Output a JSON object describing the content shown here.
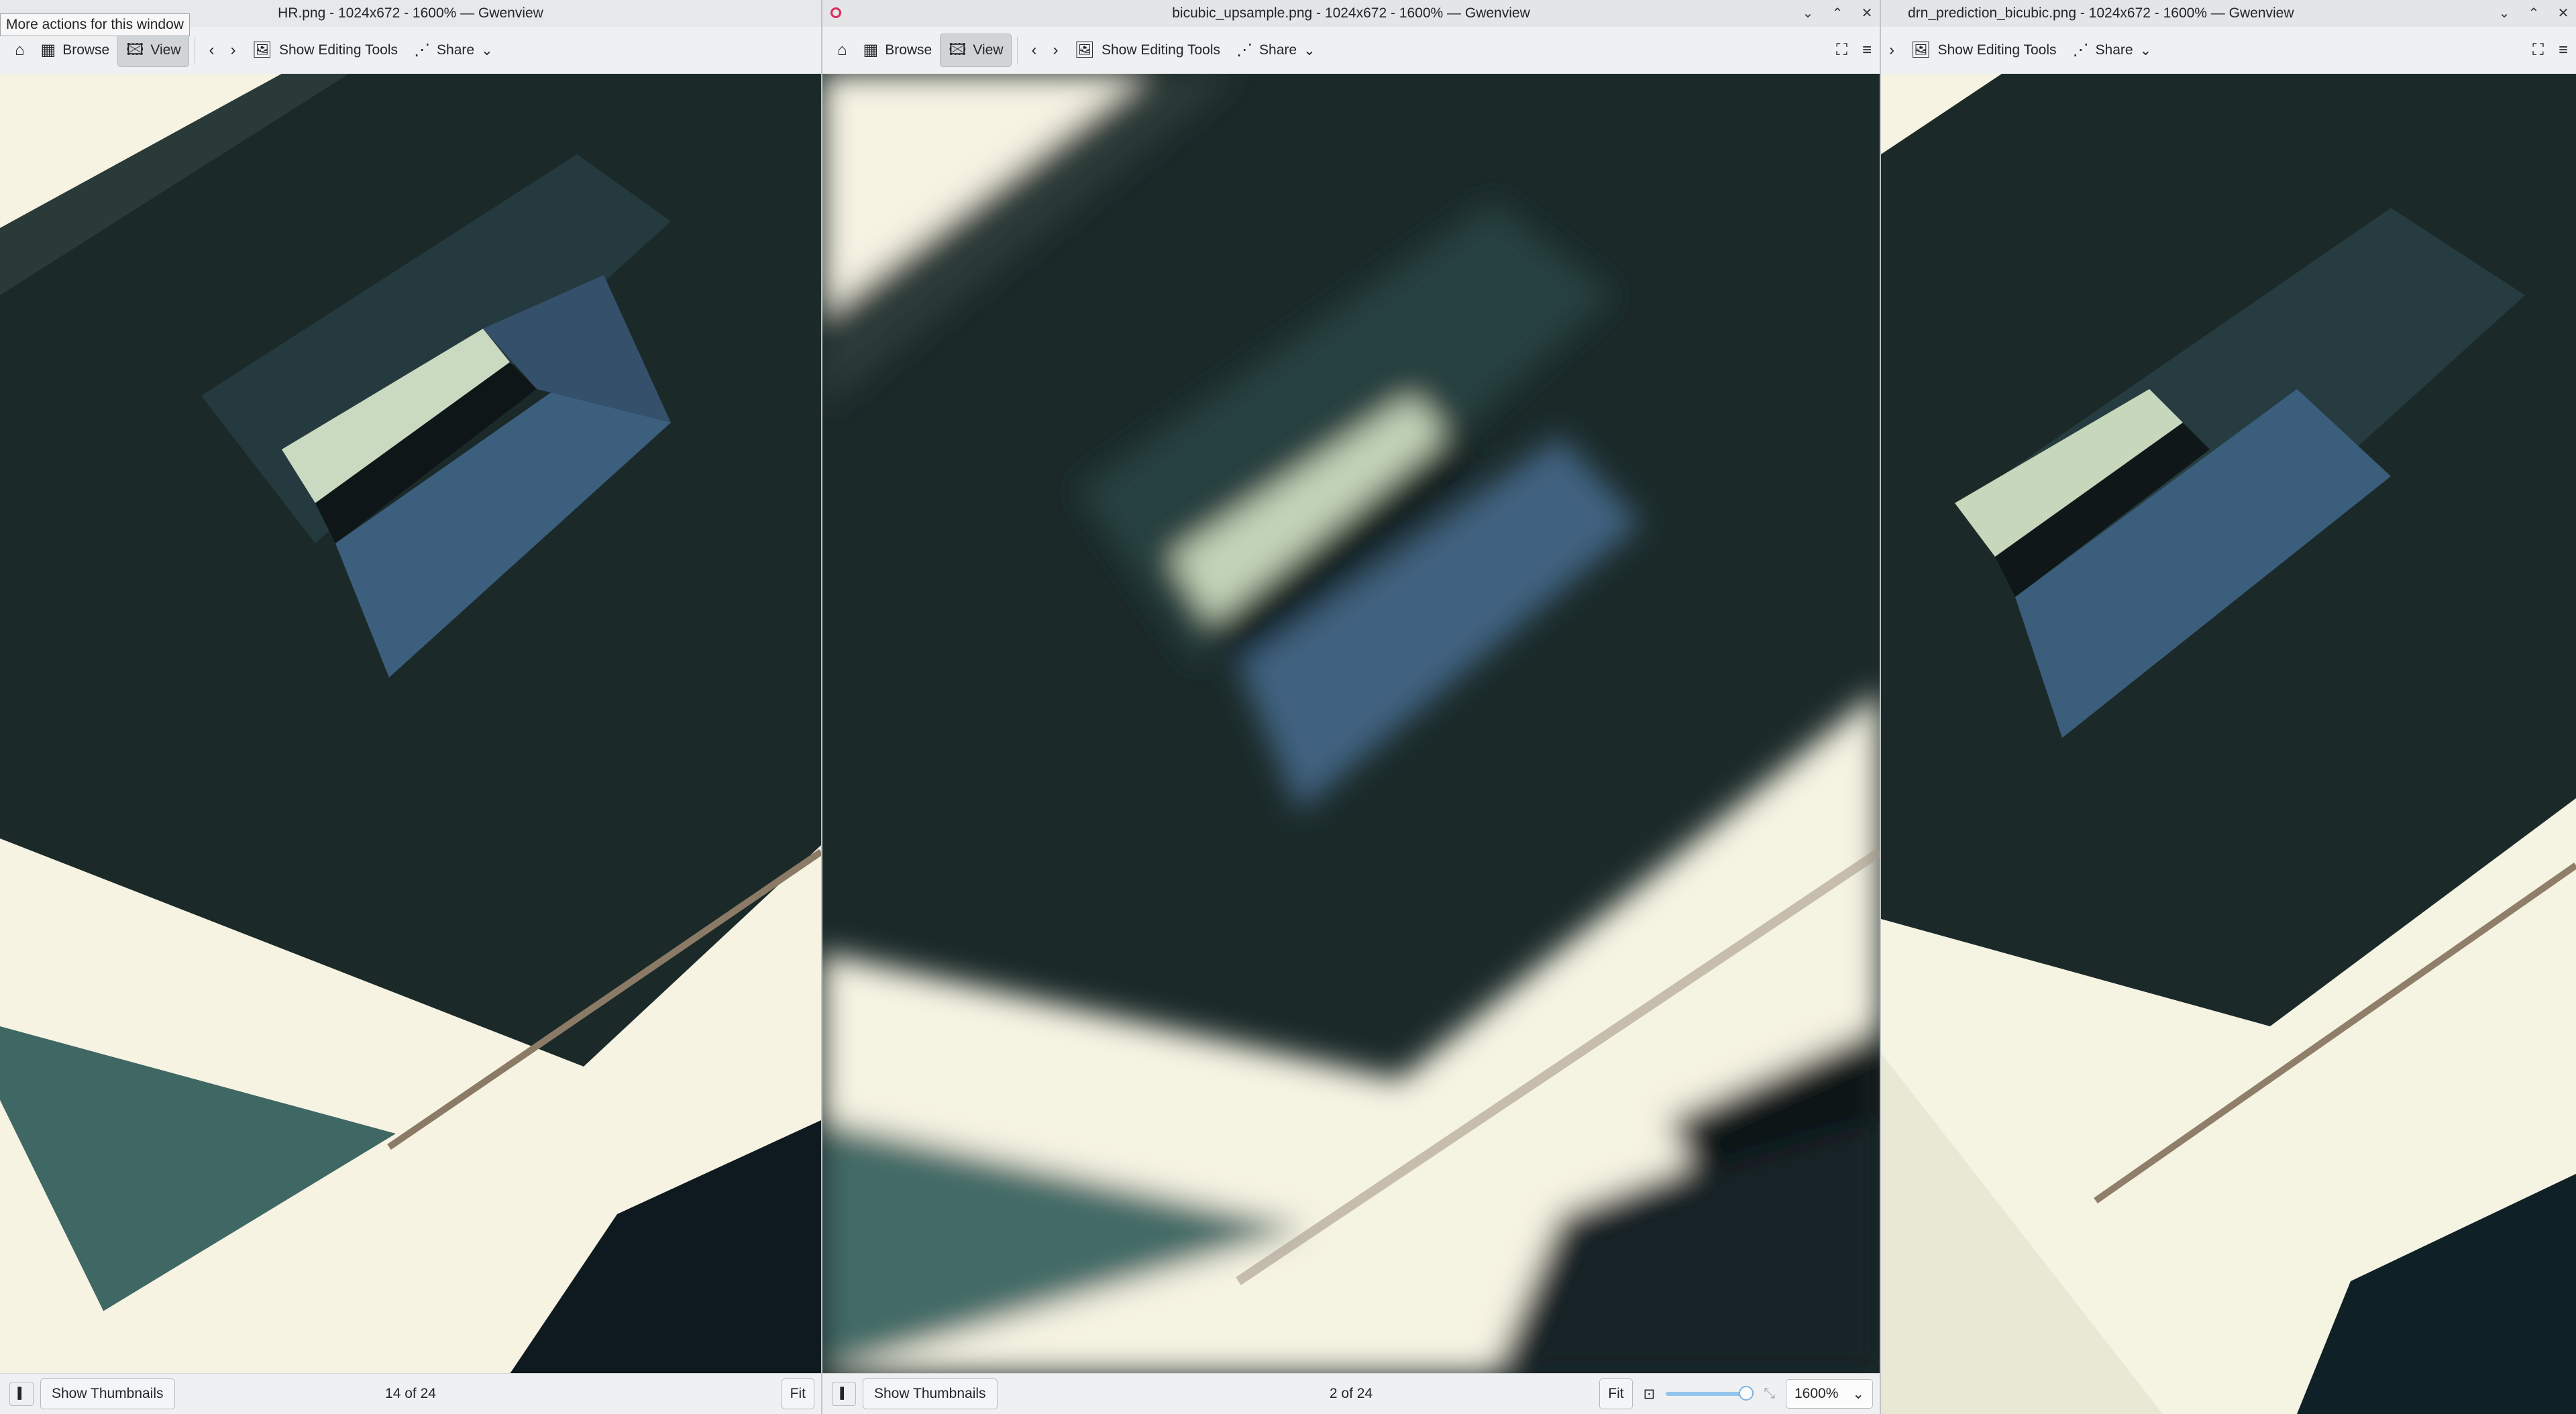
{
  "tooltip": "More actions for this window",
  "windows": [
    {
      "title": "HR.png - 1024x672 - 1600% — Gwenview",
      "toolbar": {
        "home": "⌂",
        "browse": "Browse",
        "view": "View",
        "prev": "‹",
        "next": "›",
        "edit": "Show Editing Tools",
        "share": "Share"
      },
      "status": {
        "thumbs": "Show Thumbnails",
        "count": "14 of 24",
        "fit": "Fit"
      }
    },
    {
      "title": "bicubic_upsample.png - 1024x672 - 1600% — Gwenview",
      "toolbar": {
        "home": "⌂",
        "browse": "Browse",
        "view": "View",
        "prev": "‹",
        "next": "›",
        "edit": "Show Editing Tools",
        "share": "Share"
      },
      "status": {
        "thumbs": "Show Thumbnails",
        "count": "2 of 24",
        "fit": "Fit",
        "zoom": "1600%",
        "zoom_slider_fraction": 0.92
      }
    },
    {
      "title": "drn_prediction_bicubic.png - 1024x672 - 1600% — Gwenview",
      "toolbar": {
        "next": "›",
        "edit": "Show Editing Tools",
        "share": "Share"
      }
    }
  ],
  "icons": {
    "minimize": "⌄",
    "maximize": "⌃",
    "close": "✕",
    "fullscreen": "⛶",
    "menu": "≡",
    "dropdown": "⌄",
    "share": "⋰",
    "edit": "🖼",
    "sidebar": "▌",
    "zoom_fit": "⊡",
    "zoom_full": "⤡"
  },
  "colors": {
    "accent": "#3daee9",
    "titlebar": "#e3e5e7",
    "toolbar": "#eff0f1",
    "image_dark": "#1a2624",
    "image_light": "#f7f5e6"
  }
}
